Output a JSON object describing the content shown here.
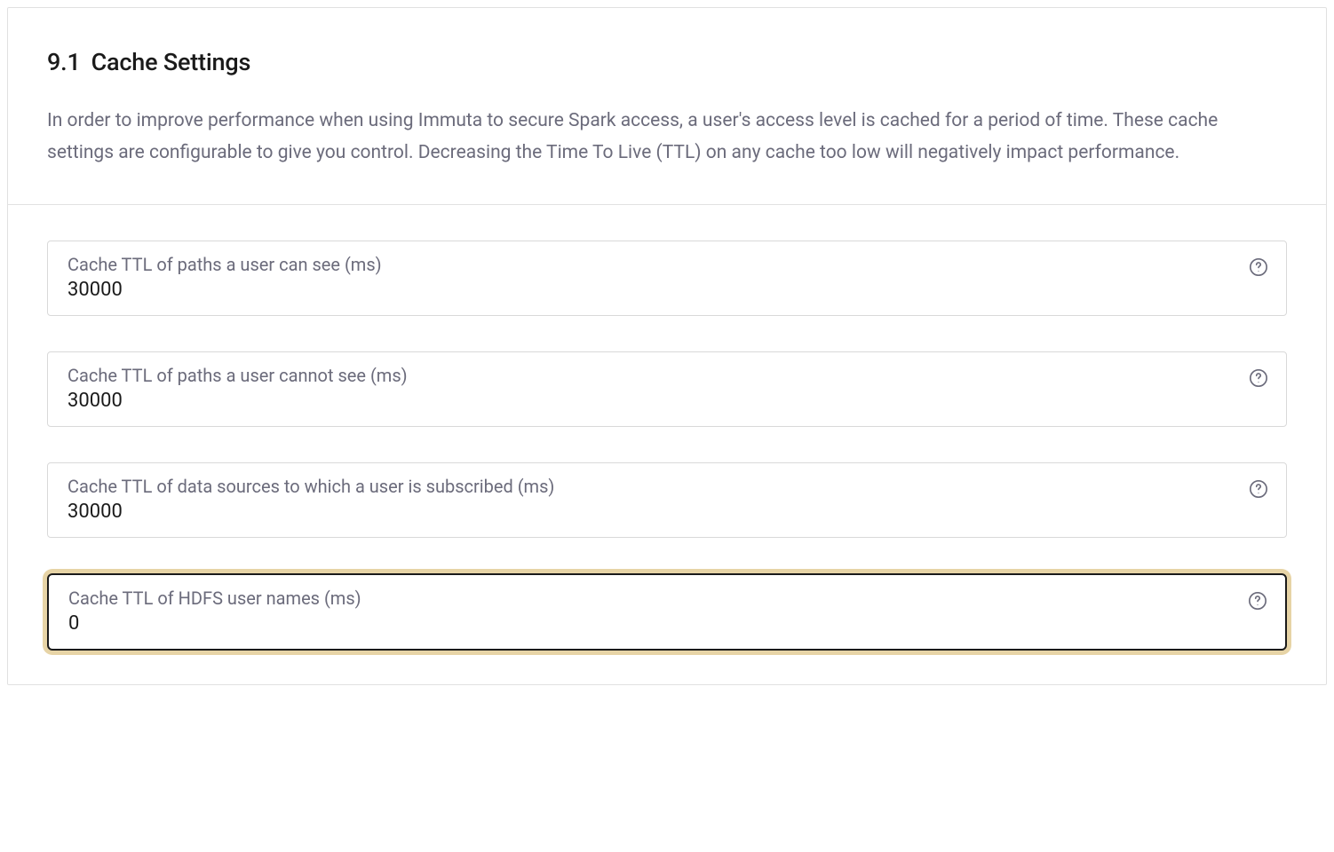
{
  "section": {
    "number": "9.1",
    "title": "Cache Settings",
    "description": "In order to improve performance when using Immuta to secure Spark access, a user's access level is cached for a period of time. These cache settings are configurable to give you control. Decreasing the Time To Live (TTL) on any cache too low will negatively impact performance."
  },
  "fields": {
    "paths_can_see": {
      "label": "Cache TTL of paths a user can see (ms)",
      "value": "30000"
    },
    "paths_cannot_see": {
      "label": "Cache TTL of paths a user cannot see (ms)",
      "value": "30000"
    },
    "data_sources_subscribed": {
      "label": "Cache TTL of data sources to which a user is subscribed (ms)",
      "value": "30000"
    },
    "hdfs_user_names": {
      "label": "Cache TTL of HDFS user names (ms)",
      "value": "0"
    }
  }
}
